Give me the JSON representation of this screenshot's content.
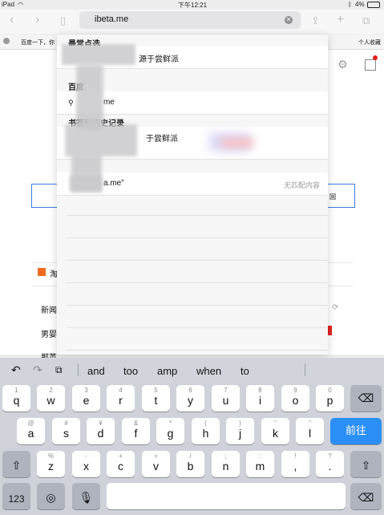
{
  "status": {
    "device": "iPad",
    "time": "下午12:21",
    "battery": "4%"
  },
  "browser": {
    "url": "ibeta.me",
    "favorites_bar_text": "百度一下，你",
    "favorites_right": "个人收藏"
  },
  "popover": {
    "section_top_hits": "最常点选",
    "top_hit_text": "源于尝鲜派",
    "section_baidu": "百度",
    "search_suggestion": "me",
    "section_bookmarks": "书签和历史记录",
    "bookmark_item": "于尝鲜派",
    "no_match_text": "a.me”",
    "no_match_label": "无匹配内容"
  },
  "background_page": {
    "news_label": "新闻",
    "item_1": "男婴",
    "item_2": "那英",
    "taobao": "淘"
  },
  "shortcuts": {
    "suggestions": [
      "and",
      "too",
      "amp",
      "when",
      "to"
    ]
  },
  "keyboard": {
    "row1": [
      [
        "1",
        "q"
      ],
      [
        "2",
        "w"
      ],
      [
        "3",
        "e"
      ],
      [
        "4",
        "r"
      ],
      [
        "5",
        "t"
      ],
      [
        "6",
        "y"
      ],
      [
        "7",
        "u"
      ],
      [
        "8",
        "i"
      ],
      [
        "9",
        "o"
      ],
      [
        "0",
        "p"
      ]
    ],
    "row2": [
      [
        "@",
        "a"
      ],
      [
        "#",
        "s"
      ],
      [
        "¥",
        "d"
      ],
      [
        "&",
        "f"
      ],
      [
        "*",
        "g"
      ],
      [
        "(",
        "h"
      ],
      [
        ")",
        "j"
      ],
      [
        "“",
        "k"
      ],
      [
        "”",
        "l"
      ]
    ],
    "row3": [
      [
        "%",
        "z"
      ],
      [
        "-",
        "x"
      ],
      [
        "+",
        "c"
      ],
      [
        "=",
        "v"
      ],
      [
        "/",
        "b"
      ],
      [
        ";",
        "n"
      ],
      [
        ":",
        "m"
      ],
      [
        "!",
        ","
      ],
      [
        "?",
        "."
      ]
    ],
    "go_label": "前往",
    "numbers_label": "123"
  }
}
